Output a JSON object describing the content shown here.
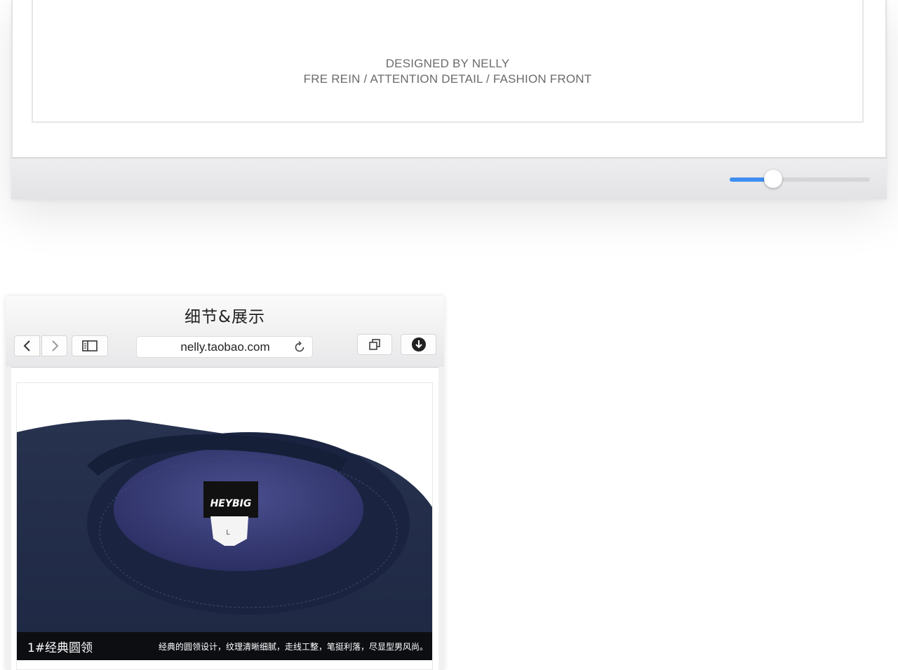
{
  "top_window": {
    "credit_line_1": "DESIGNED BY NELLY",
    "credit_line_2": "FRE REIN / ATTENTION DETAIL / FASHION FRONT",
    "slider": {
      "value": 0.31,
      "accent": "#3e8ef0"
    }
  },
  "browser": {
    "title": "细节&展示",
    "url": "nelly.taobao.com",
    "icons": {
      "back": "chevron-left-icon",
      "forward": "chevron-right-icon",
      "sidebar": "sidebar-icon",
      "reload": "reload-icon",
      "tabs": "tabs-icon",
      "download": "download-icon"
    }
  },
  "product": {
    "brand_label": "HEYBIG",
    "size_label": "L",
    "sweater_color": "#1f2a4a",
    "caption_title": "1#经典圆领",
    "caption_desc": "经典的圆领设计，纹理清晰细腻，走线工整，笔挺利落，尽显型男风尚。"
  }
}
